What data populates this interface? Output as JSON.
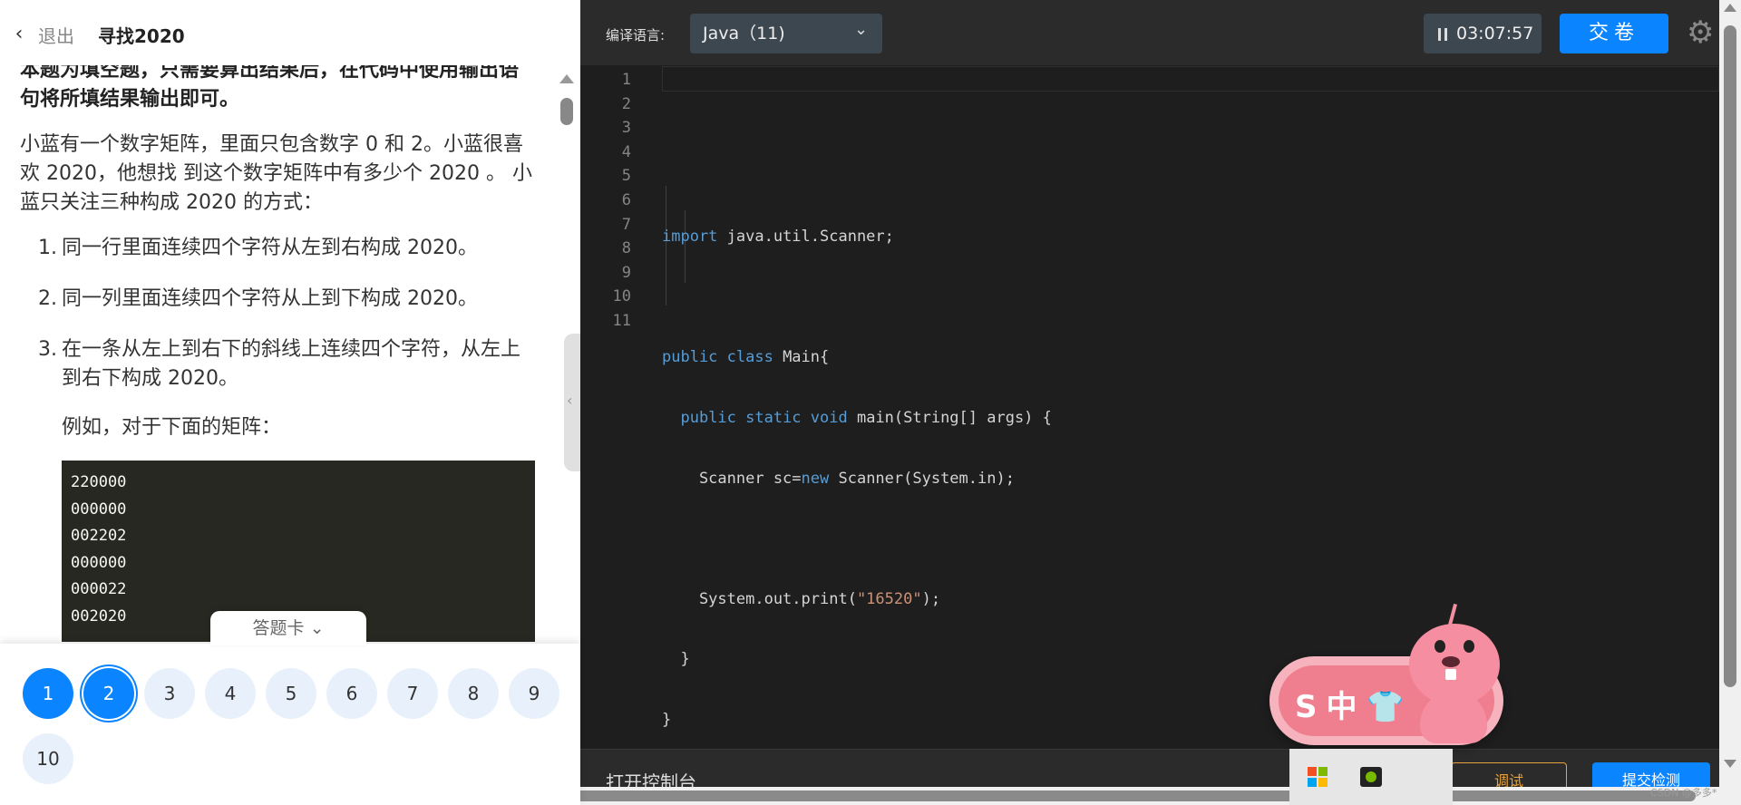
{
  "header": {
    "back_label": "退出",
    "title": "寻找2020"
  },
  "problem": {
    "intro": "本题为填空题，只需要算出结果后，在代码中使用输出语句将所填结果输出即可。",
    "description": "小蓝有一个数字矩阵，里面只包含数字 0 和 2。小蓝很喜欢 2020，他想找 到这个数字矩阵中有多少个 2020 。 小蓝只关注三种构成 2020 的方式：",
    "rules": [
      {
        "num": "1.",
        "text": "同一行里面连续四个字符从左到右构成 2020。"
      },
      {
        "num": "2.",
        "text": "同一列里面连续四个字符从上到下构成 2020。"
      },
      {
        "num": "3.",
        "text": "在一条从左上到右下的斜线上连续四个字符，从左上到右下构成 2020。"
      }
    ],
    "example_label": "例如，对于下面的矩阵：",
    "matrix": [
      "220000",
      "000000",
      "002202",
      "000000",
      "000022",
      "002020"
    ]
  },
  "answer_card": {
    "tab_label": "答题卡",
    "questions": [
      "1",
      "2",
      "3",
      "4",
      "5",
      "6",
      "7",
      "8",
      "9",
      "10"
    ],
    "answered": [
      "1",
      "2"
    ],
    "current": "2"
  },
  "toolbar": {
    "lang_label": "编译语言:",
    "lang_value": "Java（11)",
    "timer": "03:07:57",
    "submit_label": "交卷"
  },
  "editor": {
    "line_numbers": [
      "1",
      "2",
      "3",
      "4",
      "5",
      "6",
      "7",
      "8",
      "9",
      "10",
      "11"
    ]
  },
  "console": {
    "label": "打开控制台",
    "debug_label": "调试",
    "check_label": "提交检测"
  },
  "ime": {
    "chars": "S中👕"
  },
  "watermark": "CSDN @多多*",
  "colors": {
    "accent": "#0a84ff",
    "editor_bg": "#1e1e1e",
    "keyword": "#569cd6",
    "string": "#ce9178"
  }
}
